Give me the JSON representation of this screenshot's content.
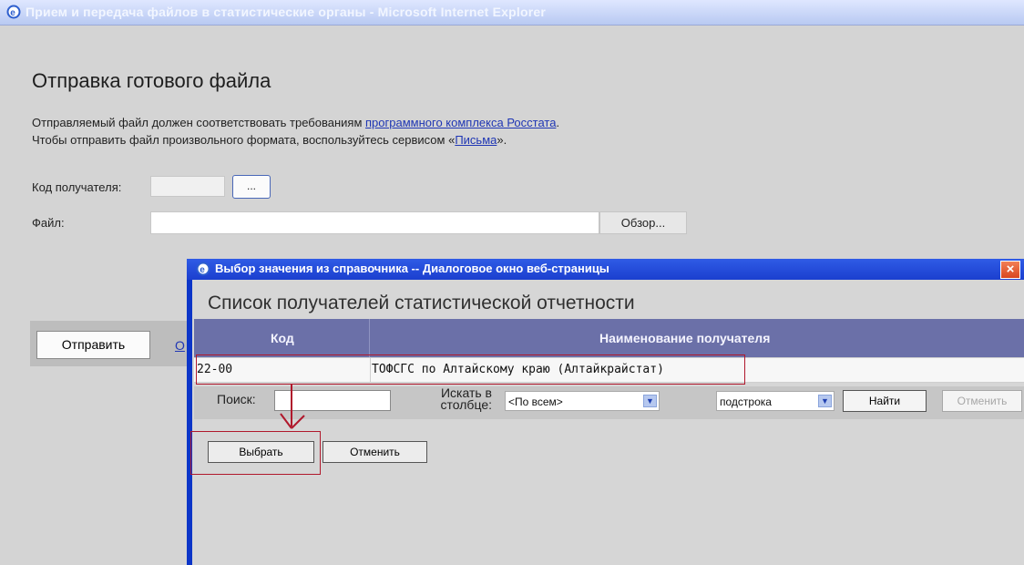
{
  "window": {
    "title": "Прием и передача файлов в статистические органы - Microsoft Internet Explorer"
  },
  "page": {
    "heading": "Отправка готового файла",
    "line1_prefix": "Отправляемый файл должен соответствовать требованиям ",
    "line1_link": "программного комплекса Росстата",
    "line1_suffix": ".",
    "line2_prefix": "Чтобы отправить файл произвольного формата, воспользуйтесь сервисом «",
    "line2_link": "Письма",
    "line2_suffix": "».",
    "recipient_label": "Код получателя:",
    "recipient_value": "",
    "browse_small": "...",
    "file_label": "Файл:",
    "file_value": "",
    "file_browse": "Обзор...",
    "send_button": "Отправить",
    "partial_link": "О"
  },
  "dialog": {
    "title": "Выбор значения из справочника -- Диалоговое окно веб-страницы",
    "subtitle": "Список получателей статистической отчетности",
    "columns": [
      "Код",
      "Наименование получателя"
    ],
    "rows": [
      {
        "code": "22-00",
        "name": "ТОФСГС по Алтайскому краю (Алтайкрайстат)"
      }
    ],
    "search_label": "Поиск:",
    "search_value": "",
    "search_in_label_1": "Искать в",
    "search_in_label_2": "столбце:",
    "column_select_value": "<По всем>",
    "match_select_value": "подстрока",
    "find_button": "Найти",
    "cancel_search_button": "Отменить",
    "choose_button": "Выбрать",
    "cancel_button": "Отменить"
  }
}
